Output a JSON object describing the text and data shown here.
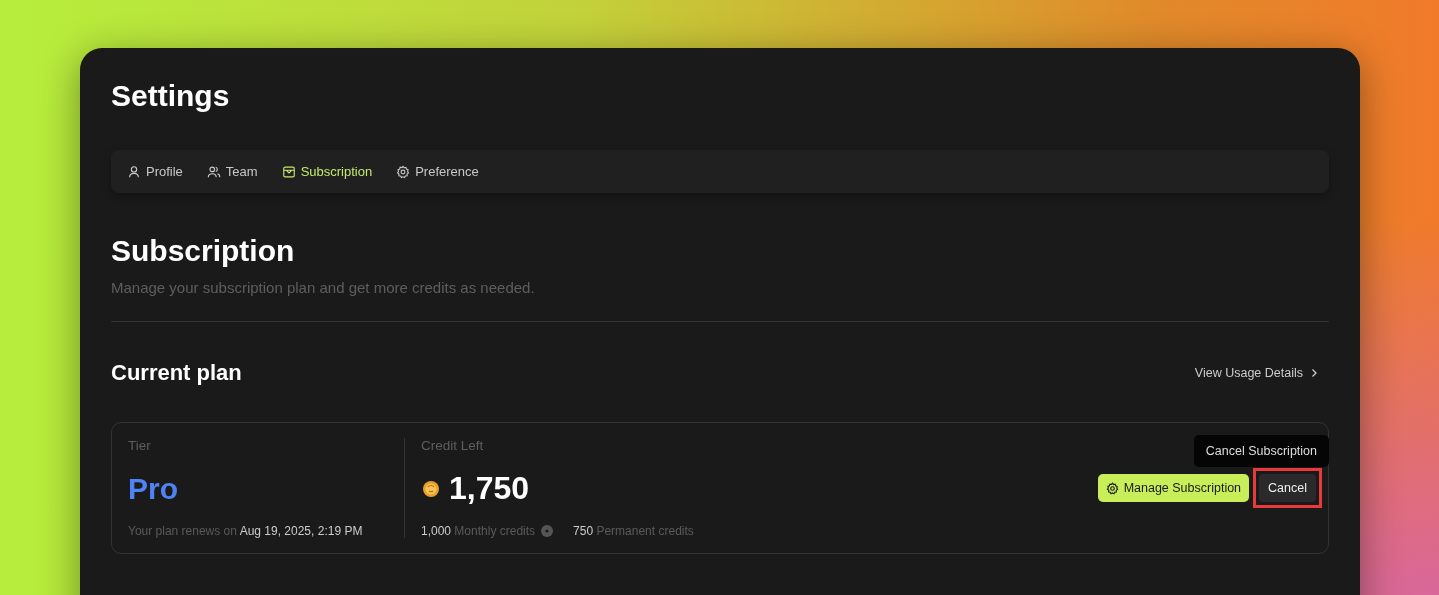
{
  "title": "Settings",
  "tabs": [
    {
      "label": "Profile",
      "selected": false
    },
    {
      "label": "Team",
      "selected": false
    },
    {
      "label": "Subscription",
      "selected": true
    },
    {
      "label": "Preference",
      "selected": false
    }
  ],
  "section": {
    "title": "Subscription",
    "description": "Manage your subscription plan and get more credits as needed."
  },
  "current_plan": {
    "title": "Current plan",
    "usage_link": "View Usage Details",
    "tier": {
      "label": "Tier",
      "name": "Pro",
      "renew_prefix": "Your plan renews on",
      "renew_date": "Aug 19, 2025, 2:19 PM"
    },
    "credits": {
      "label": "Credit Left",
      "total": "1,750",
      "monthly_value": "1,000",
      "monthly_label": "Monthly credits",
      "permanent_value": "750",
      "permanent_label": "Permanent credits"
    },
    "manage_button": "Manage Subscription",
    "cancel_button": "Cancel",
    "tooltip": "Cancel Subscription"
  }
}
